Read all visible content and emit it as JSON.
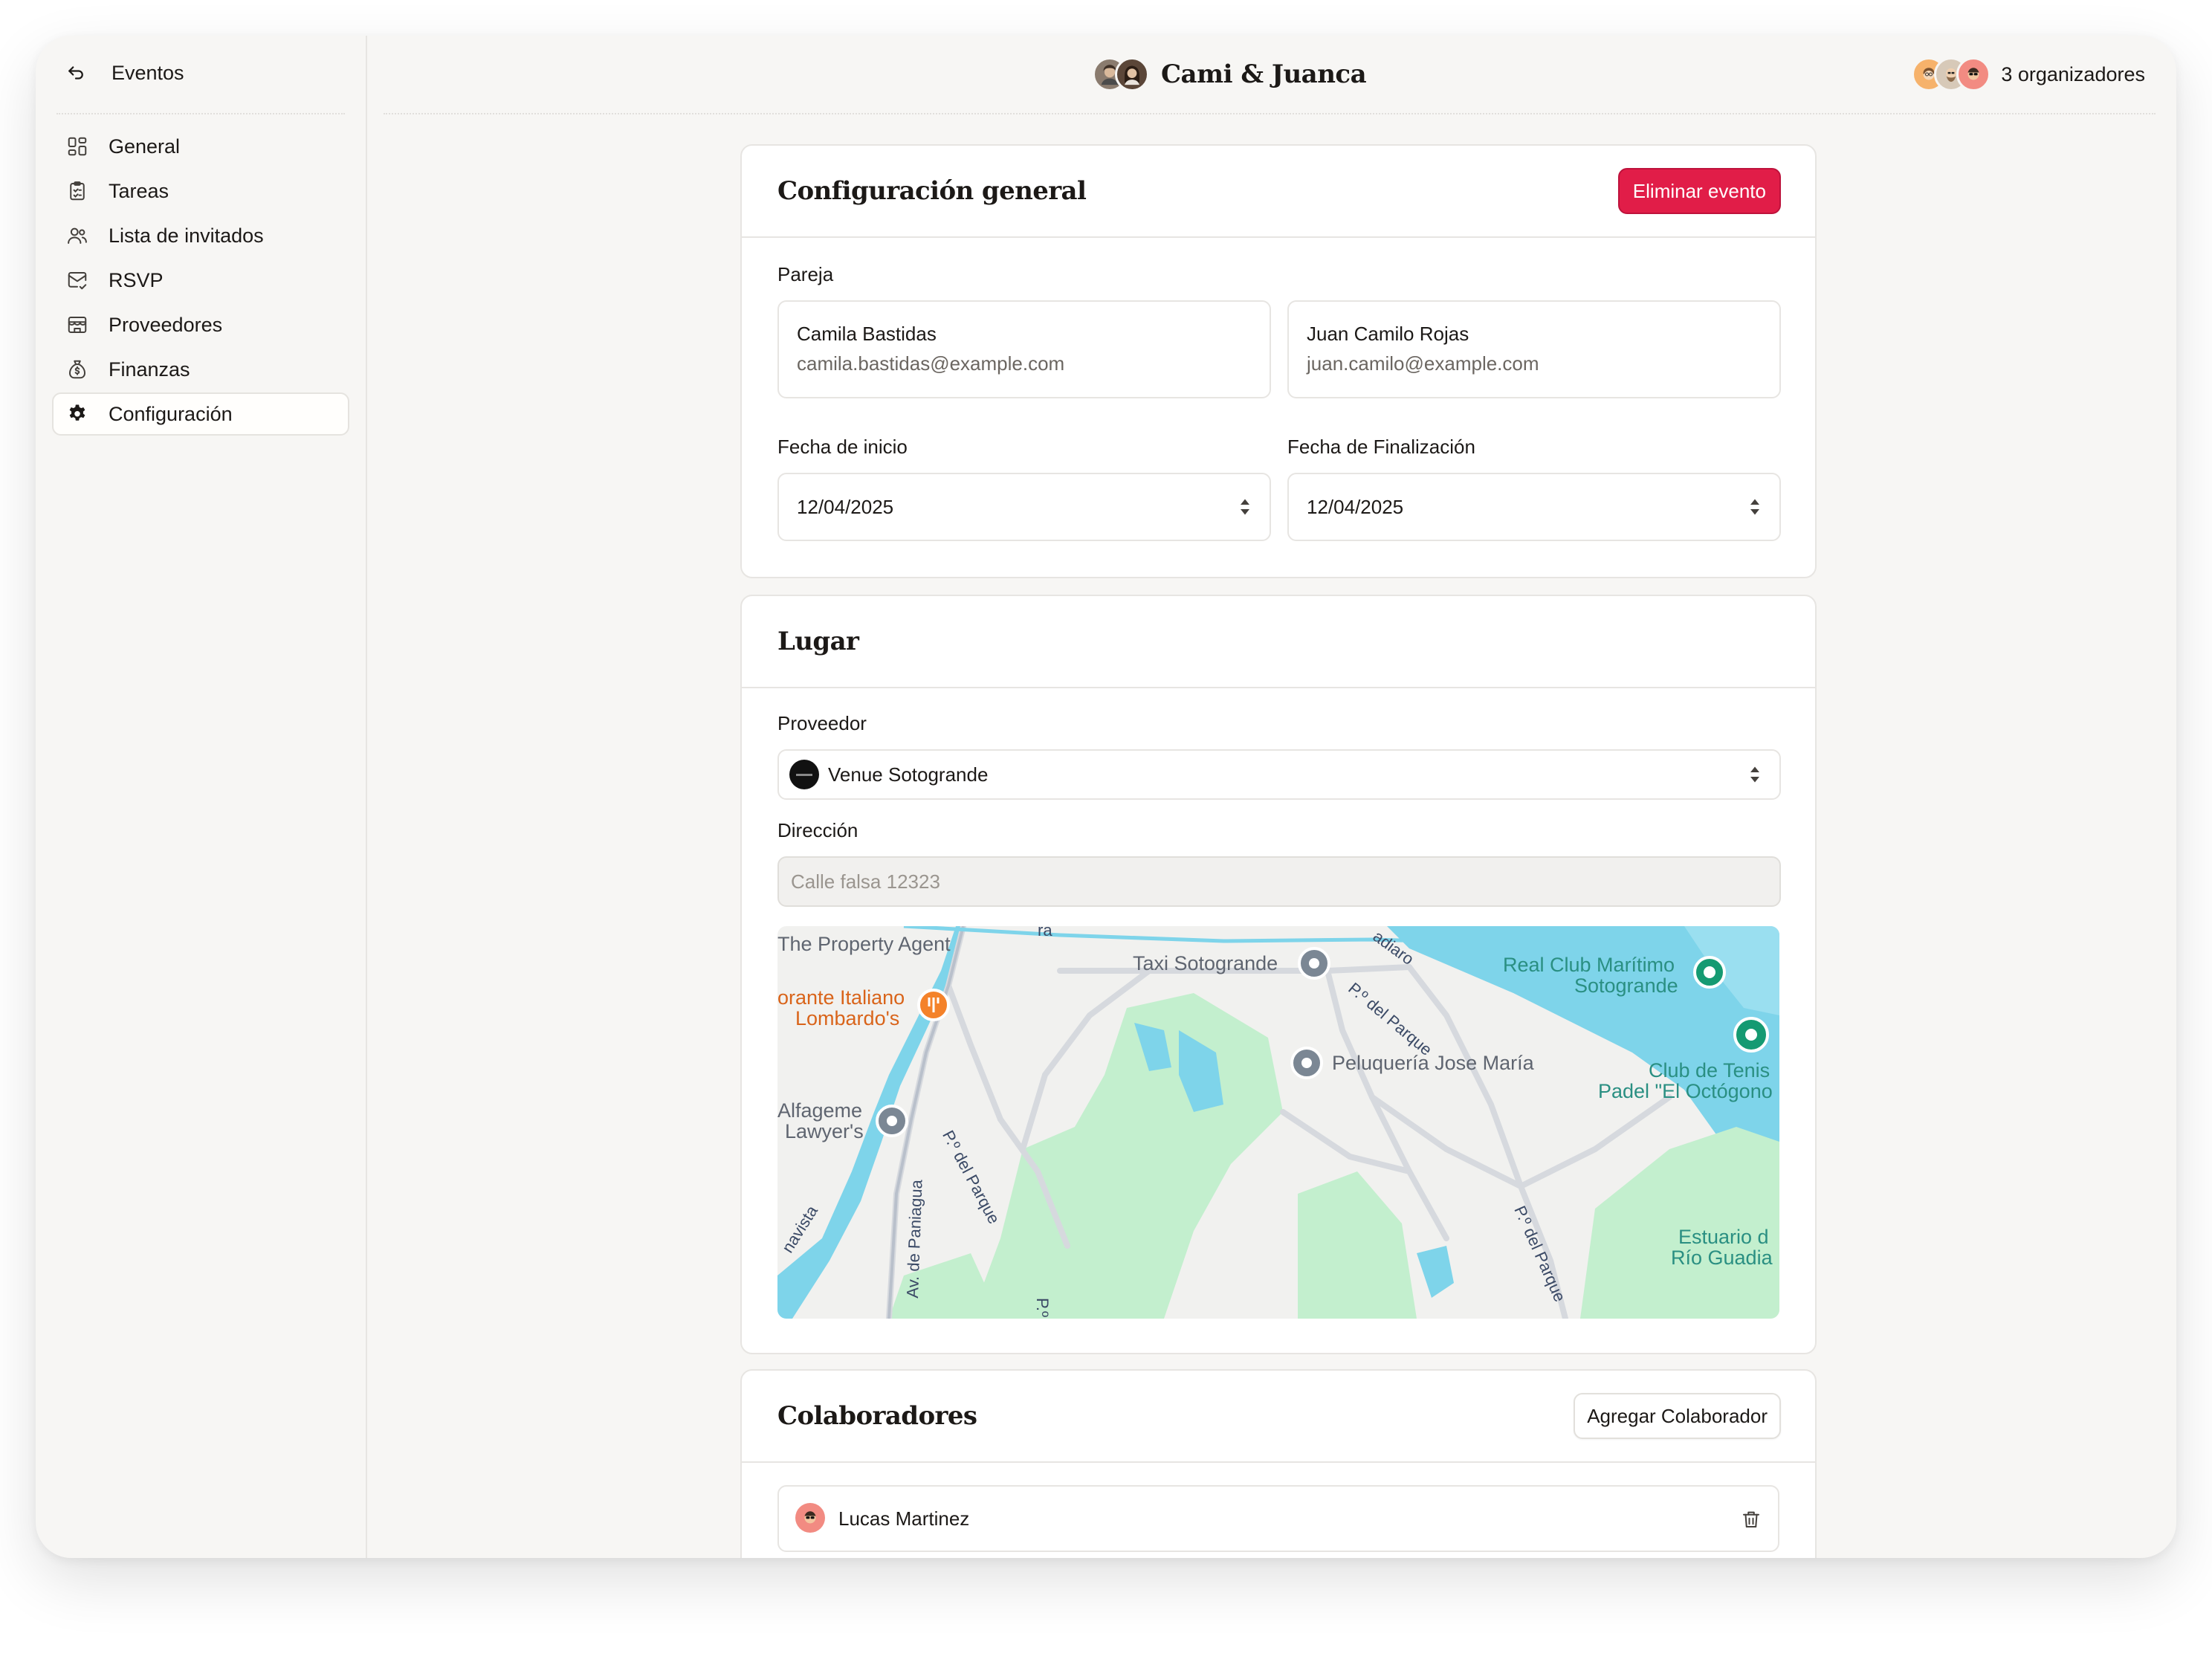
{
  "sidebar": {
    "back_label": "Eventos",
    "items": [
      {
        "label": "General",
        "icon": "grid-icon"
      },
      {
        "label": "Tareas",
        "icon": "clipboard-icon"
      },
      {
        "label": "Lista de invitados",
        "icon": "users-icon"
      },
      {
        "label": "RSVP",
        "icon": "mail-check-icon"
      },
      {
        "label": "Proveedores",
        "icon": "store-icon"
      },
      {
        "label": "Finanzas",
        "icon": "money-bag-icon"
      },
      {
        "label": "Configuración",
        "icon": "gear-icon",
        "active": true
      }
    ]
  },
  "header": {
    "event_name": "Cami & Juanca",
    "organizers_label": "3 organizadores"
  },
  "general": {
    "title": "Configuración general",
    "delete_label": "Eliminar evento",
    "couple_label": "Pareja",
    "partner1": {
      "name": "Camila Bastidas",
      "email": "camila.bastidas@example.com"
    },
    "partner2": {
      "name": "Juan Camilo Rojas",
      "email": "juan.camilo@example.com"
    },
    "start_label": "Fecha de inicio",
    "start_value": "12/04/2025",
    "end_label": "Fecha de Finalización",
    "end_value": "12/04/2025"
  },
  "lugar": {
    "title": "Lugar",
    "provider_label": "Proveedor",
    "provider_value": "Venue Sotogrande",
    "address_label": "Dirección",
    "address_placeholder": "Calle falsa 12323",
    "map_labels": {
      "property_agent": "The Property Agent",
      "italiano_1": "orante Italiano",
      "italiano_2": "Lombardo's",
      "alfageme_1": "Alfageme",
      "alfageme_2": "Lawyer's",
      "taxi": "Taxi Sotogrande",
      "peluqueria": "Peluquería Jose María",
      "real_club_1": "Real Club Marítimo",
      "real_club_2": "Sotogrande",
      "tenis_1": "Club de Tenis",
      "tenis_2": "Padel \"El Octógono",
      "estuario_1": "Estuario d",
      "estuario_2": "Río Guadia",
      "road_parque": "P.º del Parque",
      "road_paniagua": "Av. de Paniagua",
      "road_avista": "navista",
      "road_diaro": "adiaro",
      "road_ra": "ra",
      "road_p": "P.º"
    }
  },
  "colaboradores": {
    "title": "Colaboradores",
    "add_label": "Agregar Colaborador",
    "items": [
      {
        "name": "Lucas Martinez"
      }
    ]
  },
  "colors": {
    "danger": "#e11d48",
    "background": "#f7f6f4",
    "map_land": "#f1f1ef",
    "map_water": "#7ed4ea",
    "map_park": "#c3efce"
  }
}
